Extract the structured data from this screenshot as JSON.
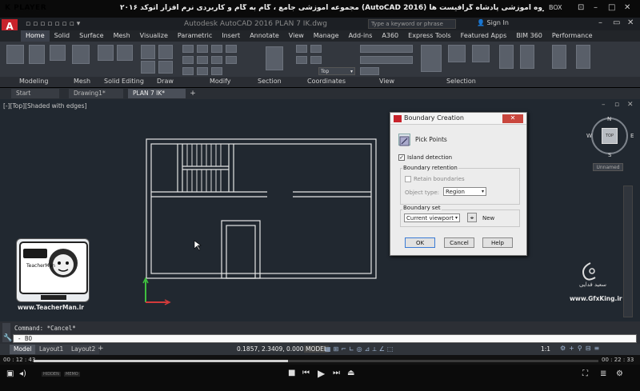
{
  "player": {
    "logo": "K PLAYER",
    "title": "مجموعه آموزشی جامع ، گام به گام و کاربردی نرم افزار اتوکد ۲۰۱۶ (AutoCAD 2016) مدرس : سعید فدایی (تیچرمن) گروه آموزشی پادشاه گرافیست ها",
    "badge": "BOX",
    "time_elapsed": "00 : 12 : 43",
    "time_total": "00 : 22 : 33",
    "progress": 0.45,
    "mini_labels": [
      "HIDDEN",
      "MEMO",
      "BOX"
    ]
  },
  "acad": {
    "logo": "A",
    "filename": "Autodesk AutoCAD 2016  PLAN 7 IK.dwg",
    "search_placeholder": "Type a keyword or phrase",
    "signin": "Sign In"
  },
  "ribbon": {
    "tabs": [
      "Home",
      "Solid",
      "Surface",
      "Mesh",
      "Visualize",
      "Parametric",
      "Insert",
      "Annotate",
      "View",
      "Manage",
      "Add-ins",
      "A360",
      "Express Tools",
      "Featured Apps",
      "BIM 360",
      "Performance"
    ],
    "active_tab": "Home",
    "panels": [
      "Modeling",
      "Mesh",
      "Solid Editing",
      "Draw",
      "Modify",
      "Section",
      "Coordinates",
      "View",
      "Selection"
    ],
    "layer_value": "Top"
  },
  "doc_tabs": [
    "Start",
    "Drawing1*",
    "PLAN 7 IK*"
  ],
  "viewport": {
    "label": "[-][Top][Shaded with edges]",
    "wcs": "Unnamed",
    "compass": {
      "n": "N",
      "w": "W",
      "e": "E",
      "s": "S",
      "face": "TOP"
    }
  },
  "dialog": {
    "title": "Boundary Creation",
    "pick_points": "Pick Points",
    "island_detection": "Island detection",
    "island_checked": true,
    "boundary_retention": "Boundary retention",
    "retain_boundaries": "Retain boundaries",
    "object_type_label": "Object type:",
    "object_type_value": "Region",
    "boundary_set": "Boundary set",
    "boundary_set_value": "Current viewport",
    "new_label": "New",
    "ok": "OK",
    "cancel": "Cancel",
    "help": "Help"
  },
  "overlay": {
    "teacher_url": "www.TeacherMan.ir",
    "teacher_name": "TeacherMan",
    "gfx_name": "سعید فدایی",
    "gfx_url": "www.GfxKing.ir"
  },
  "command": {
    "history": "Command: *Cancel*",
    "input": "- BO"
  },
  "status": {
    "layout_tabs": [
      "Model",
      "Layout1",
      "Layout2"
    ],
    "active_layout": "Model",
    "coords": "0.1857, 2.3409, 0.0000",
    "model": "MODEL",
    "scale": "1:1"
  }
}
